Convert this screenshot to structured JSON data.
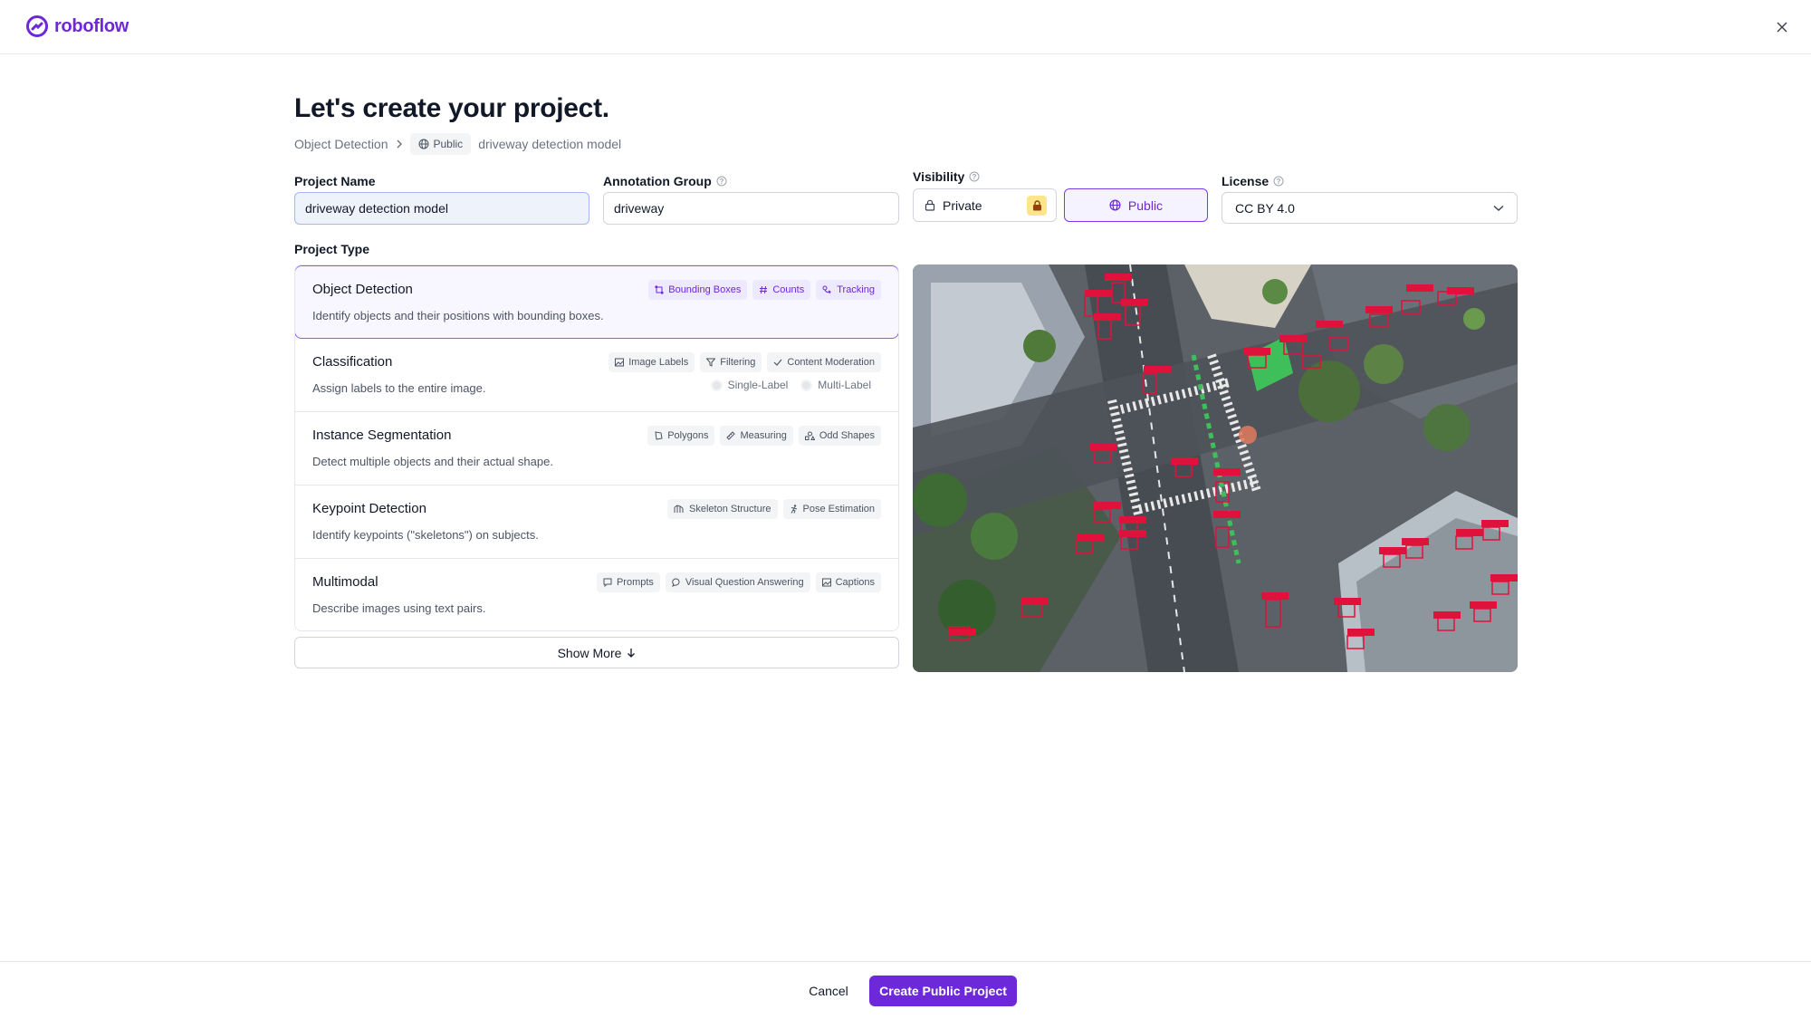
{
  "brand": {
    "name": "roboflow",
    "color": "#6d28d9"
  },
  "header": {
    "close_icon": "close-icon"
  },
  "page": {
    "title": "Let's create your project.",
    "breadcrumb": {
      "type": "Object Detection",
      "visibility": "Public",
      "project": "driveway detection model"
    }
  },
  "form": {
    "project_name": {
      "label": "Project Name",
      "value": "driveway detection model"
    },
    "annotation_group": {
      "label": "Annotation Group",
      "value": "driveway"
    },
    "visibility": {
      "label": "Visibility",
      "private_label": "Private",
      "public_label": "Public",
      "selected": "Public"
    },
    "license": {
      "label": "License",
      "value": "CC BY 4.0"
    }
  },
  "project_type": {
    "label": "Project Type",
    "options": [
      {
        "name": "Object Detection",
        "description": "Identify objects and their positions with bounding boxes.",
        "tags": [
          "Bounding Boxes",
          "Counts",
          "Tracking"
        ]
      },
      {
        "name": "Classification",
        "description": "Assign labels to the entire image.",
        "tags": [
          "Image Labels",
          "Filtering",
          "Content Moderation"
        ],
        "radios": [
          "Single-Label",
          "Multi-Label"
        ]
      },
      {
        "name": "Instance Segmentation",
        "description": "Detect multiple objects and their actual shape.",
        "tags": [
          "Polygons",
          "Measuring",
          "Odd Shapes"
        ]
      },
      {
        "name": "Keypoint Detection",
        "description": "Identify keypoints (\"skeletons\") on subjects.",
        "tags": [
          "Skeleton Structure",
          "Pose Estimation"
        ]
      },
      {
        "name": "Multimodal",
        "description": "Describe images using text pairs.",
        "tags": [
          "Prompts",
          "Visual Question Answering",
          "Captions"
        ]
      }
    ],
    "show_more": "Show More"
  },
  "footer": {
    "cancel": "Cancel",
    "create": "Create Public Project"
  }
}
